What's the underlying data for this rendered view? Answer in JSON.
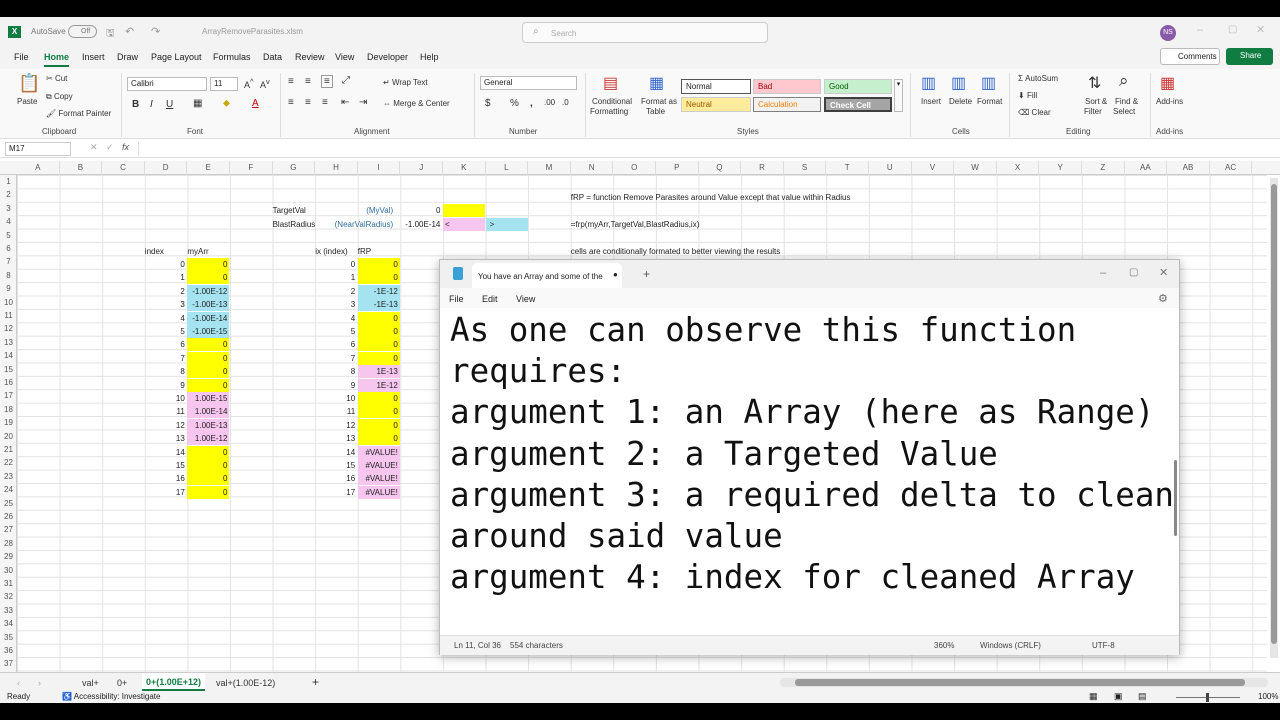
{
  "app": {
    "autosave": "AutoSave",
    "autosave_state": "Off",
    "filename": "ArrayRemoveParasites.xlsm",
    "search_placeholder": "Search",
    "user_initials": "NS"
  },
  "menu": [
    "File",
    "Home",
    "Insert",
    "Draw",
    "Page Layout",
    "Formulas",
    "Data",
    "Review",
    "View",
    "Developer",
    "Help"
  ],
  "actions": {
    "comments": "Comments",
    "share": "Share"
  },
  "ribbon": {
    "paste": "Paste",
    "cut": "Cut",
    "copy": "Copy",
    "format_painter": "Format Painter",
    "clipboard": "Clipboard",
    "font_name": "Calibri",
    "font_size": "11",
    "font": "Font",
    "wrap": "Wrap Text",
    "merge": "Merge & Center",
    "alignment": "Alignment",
    "num_format": "General",
    "number": "Number",
    "cond": "Conditional",
    "cond2": "Formatting",
    "fmt_table": "Format as",
    "fmt_table2": "Table",
    "styles": [
      "Normal",
      "Bad",
      "Good",
      "Neutral",
      "Calculation",
      "Check Cell"
    ],
    "styles_label": "Styles",
    "insert": "Insert",
    "delete": "Delete",
    "format": "Format",
    "cells": "Cells",
    "autosum": "AutoSum",
    "fill": "Fill",
    "clear": "Clear",
    "sort": "Sort &",
    "sort2": "Filter",
    "find": "Find &",
    "find2": "Select",
    "editing": "Editing",
    "addins": "Add-ins",
    "addins_label": "Add-ins"
  },
  "formula": {
    "namebox": "M17",
    "fx": "fx",
    "value": ""
  },
  "columns": [
    "A",
    "B",
    "C",
    "D",
    "E",
    "F",
    "G",
    "H",
    "I",
    "J",
    "K",
    "L",
    "M",
    "N",
    "O",
    "P",
    "Q",
    "R",
    "S",
    "T",
    "U",
    "V",
    "W",
    "X",
    "Y",
    "Z",
    "AA",
    "AB",
    "AC"
  ],
  "rows": [
    "1",
    "2",
    "3",
    "4",
    "5",
    "6",
    "7",
    "8",
    "9",
    "10",
    "11",
    "12",
    "13",
    "14",
    "15",
    "16",
    "17",
    "18",
    "19",
    "20",
    "21",
    "22",
    "23",
    "24",
    "25",
    "26",
    "27",
    "28",
    "29",
    "30",
    "31",
    "32",
    "33",
    "34",
    "35",
    "36",
    "37"
  ],
  "cells": {
    "n1": "fRP = function Remove Parasites around Value except that value within Radius",
    "g2": "TargetVal",
    "h2": "(MyVal)",
    "j2": "0",
    "g3": "BlastRadius",
    "h3": "(NearValRadius)",
    "j3": "-1.00E-14",
    "k3": "<",
    "l3": ">",
    "n3": "=frp(myArr,TargetVal,BlastRadius,ix)",
    "n5": "cells are conditionally formated to better viewing the results",
    "d5": "index",
    "e5": "myArr",
    "h5": "ix (index)",
    "i5": "fRP",
    "index": [
      "0",
      "1",
      "2",
      "3",
      "4",
      "5",
      "6",
      "7",
      "8",
      "9",
      "10",
      "11",
      "12",
      "13",
      "14",
      "15",
      "16",
      "17"
    ],
    "myarr": [
      "0",
      "0",
      "-1.00E-12",
      "-1.00E-13",
      "-1.00E-14",
      "-1.00E-15",
      "0",
      "0",
      "0",
      "0",
      "1.00E-15",
      "1.00E-14",
      "1.00E-13",
      "1.00E-12",
      "0",
      "0",
      "0",
      "0"
    ],
    "ix": [
      "0",
      "1",
      "2",
      "3",
      "4",
      "5",
      "6",
      "7",
      "8",
      "9",
      "10",
      "11",
      "12",
      "13",
      "14",
      "15",
      "16",
      "17"
    ],
    "frp": [
      "0",
      "0",
      "-1E-12",
      "-1E-13",
      "0",
      "0",
      "0",
      "0",
      "1E-13",
      "1E-12",
      "0",
      "0",
      "0",
      "0",
      "#VALUE!",
      "#VALUE!",
      "#VALUE!",
      "#VALUE!"
    ]
  },
  "sheets": [
    "val+",
    "0+",
    "0+(1.00E+12)",
    "val+(1.00E-12)"
  ],
  "status": {
    "ready": "Ready",
    "accessibility": "Accessibility: Investigate",
    "zoom": "100%"
  },
  "notepad": {
    "tab_title": "You have an Array and some of the",
    "menu": [
      "File",
      "Edit",
      "View"
    ],
    "text": "As one can observe this function\nrequires:\nargument 1: an Array (here as Range)\nargument 2: a Targeted Value\nargument 3: a required delta to clean\naround said value\nargument 4: index for cleaned Array",
    "status_pos": "Ln 11, Col 36",
    "status_chars": "554 characters",
    "status_zoom": "360%",
    "status_eol": "Windows (CRLF)",
    "status_enc": "UTF-8"
  },
  "colors": {
    "accent": "#107c41",
    "yellow": "#ffff00",
    "blue": "#a6e3f0",
    "pink": "#f7c6ef"
  }
}
